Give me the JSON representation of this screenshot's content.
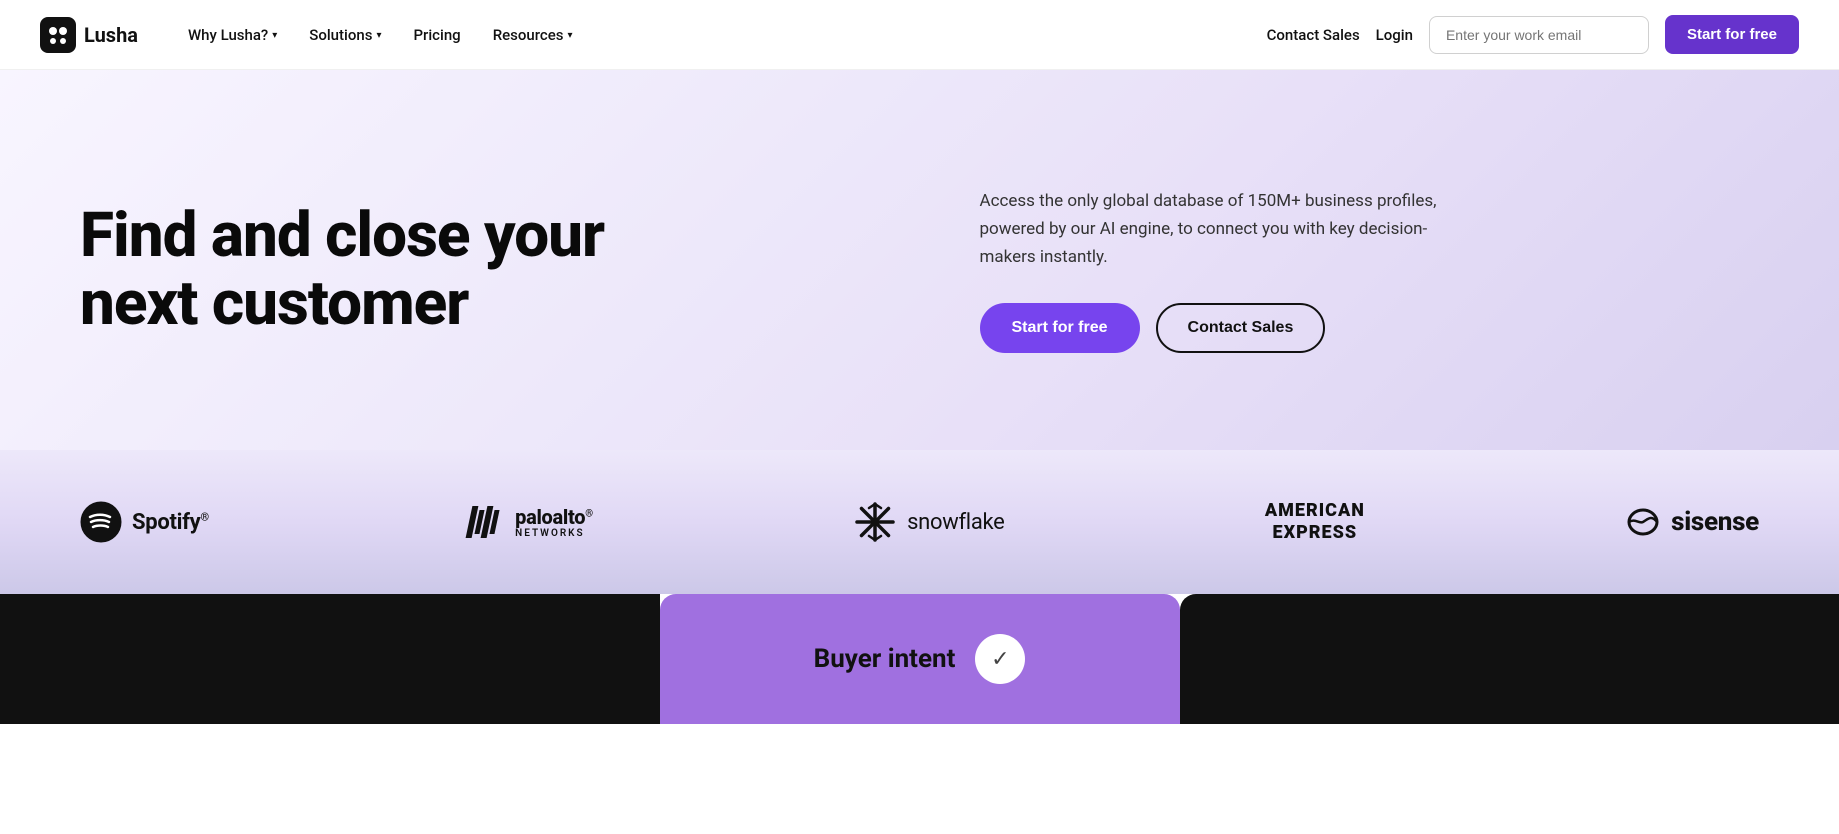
{
  "navbar": {
    "logo_text": "Lusha",
    "nav_items": [
      {
        "label": "Why Lusha?",
        "has_dropdown": true
      },
      {
        "label": "Solutions",
        "has_dropdown": true
      },
      {
        "label": "Pricing",
        "has_dropdown": false
      },
      {
        "label": "Resources",
        "has_dropdown": true
      }
    ],
    "contact_sales_label": "Contact Sales",
    "login_label": "Login",
    "email_placeholder": "Enter your work email",
    "start_btn_label": "Start for free"
  },
  "hero": {
    "title_line1": "Find and close your",
    "title_line2": "next customer",
    "description": "Access the only global database of 150M+ business profiles, powered by our AI engine, to connect you with key decision-makers instantly.",
    "start_btn_label": "Start for free",
    "contact_sales_label": "Contact Sales"
  },
  "logos": [
    {
      "name": "Spotify",
      "type": "spotify"
    },
    {
      "name": "paloalto NETWORKS",
      "type": "paloalto"
    },
    {
      "name": "snowflake",
      "type": "snowflake"
    },
    {
      "name": "AMERICAN EXPRESS",
      "type": "amex"
    },
    {
      "name": "sisense",
      "type": "sisense"
    }
  ],
  "bottom_bar": {
    "buyer_intent_label": "Buyer intent"
  },
  "colors": {
    "primary": "#6633cc",
    "hero_cta": "#7744ee"
  }
}
